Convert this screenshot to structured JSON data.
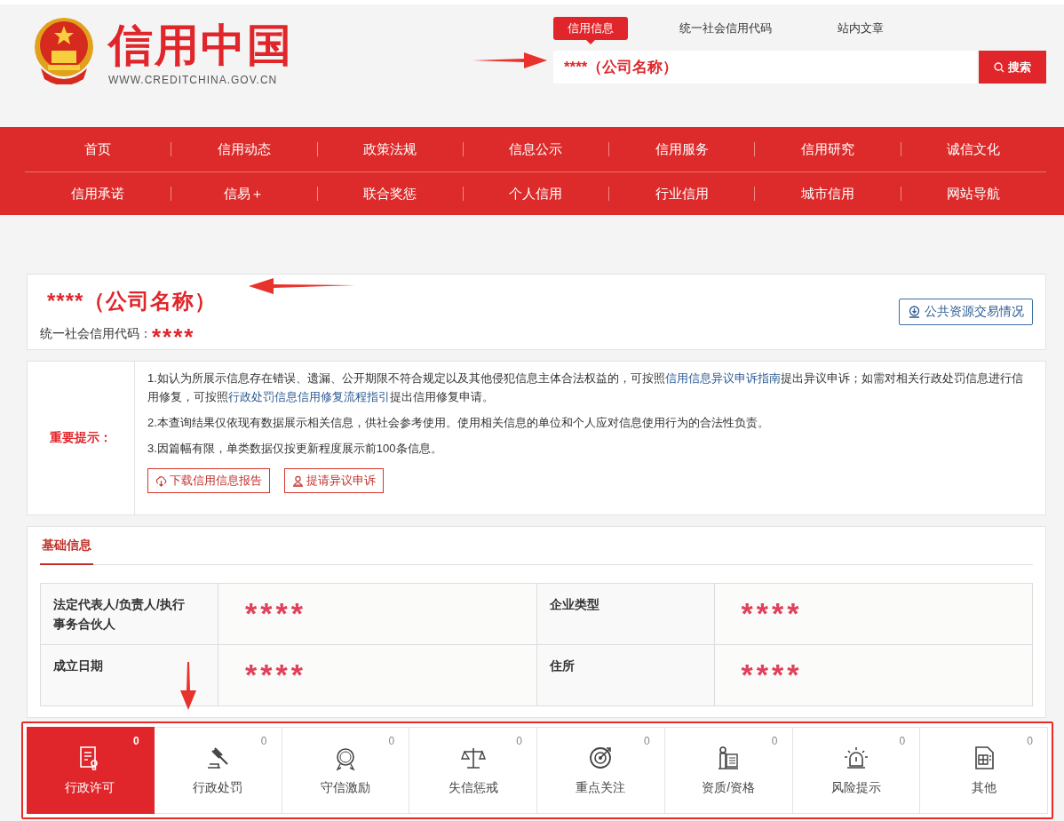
{
  "site": {
    "title": "信用中国",
    "url": "WWW.CREDITCHINA.GOV.CN"
  },
  "search": {
    "tabs": [
      {
        "label": "信用信息",
        "selected": true
      },
      {
        "label": "统一社会信用代码",
        "selected": false
      },
      {
        "label": "站内文章",
        "selected": false
      }
    ],
    "value": "****（公司名称）",
    "button": "搜索"
  },
  "nav": {
    "rows": [
      [
        "首页",
        "信用动态",
        "政策法规",
        "信息公示",
        "信用服务",
        "信用研究",
        "诚信文化"
      ],
      [
        "信用承诺",
        "信易＋",
        "联合奖惩",
        "个人信用",
        "行业信用",
        "城市信用",
        "网站导航"
      ]
    ]
  },
  "company": {
    "name": "****（公司名称）",
    "code_label": "统一社会信用代码：",
    "code": "****",
    "button": "公共资源交易情况"
  },
  "notice": {
    "title": "重要提示：",
    "items": [
      {
        "parts": [
          {
            "text": "1.如认为所展示信息存在错误、遗漏、公开期限不符合规定以及其他侵犯信息主体合法权益的，可按照"
          },
          {
            "text": "信用信息异议申诉指南",
            "kind": "link"
          },
          {
            "text": "提出异议申诉；如需对相关行政处罚信息进行信用修复，可按照"
          },
          {
            "text": "行政处罚信息信用修复流程指引",
            "kind": "link"
          },
          {
            "text": "提出信用修复申请。"
          }
        ]
      },
      {
        "parts": [
          {
            "text": "2.本查询结果仅依现有数据展示相关信息，供社会参考使用。使用相关信息的单位和个人应对信息使用行为的合法性负责。"
          }
        ]
      },
      {
        "parts": [
          {
            "text": "3.因篇幅有限，单类数据仅按更新程度展示前100条信息。"
          }
        ]
      }
    ],
    "buttons": [
      {
        "label": "下载信用信息报告",
        "kind": "download"
      },
      {
        "label": "提请异议申诉",
        "kind": "appeal"
      }
    ]
  },
  "basic_info": {
    "tab": "基础信息",
    "rows": [
      [
        {
          "label": "法定代表人/负责人/执行事务合伙人",
          "value": "****"
        },
        {
          "label": "企业类型",
          "value": "****"
        }
      ],
      [
        {
          "label": "成立日期",
          "value": "****"
        },
        {
          "label": "住所",
          "value": "****"
        }
      ]
    ]
  },
  "categories": [
    {
      "label": "行政许可",
      "count": "0",
      "selected": true,
      "kind": "license"
    },
    {
      "label": "行政处罚",
      "count": "0",
      "selected": false,
      "kind": "penalty"
    },
    {
      "label": "守信激励",
      "count": "0",
      "selected": false,
      "kind": "incentive"
    },
    {
      "label": "失信惩戒",
      "count": "0",
      "selected": false,
      "kind": "punishment"
    },
    {
      "label": "重点关注",
      "count": "0",
      "selected": false,
      "kind": "focus"
    },
    {
      "label": "资质/资格",
      "count": "0",
      "selected": false,
      "kind": "qualification"
    },
    {
      "label": "风险提示",
      "count": "0",
      "selected": false,
      "kind": "risk"
    },
    {
      "label": "其他",
      "count": "0",
      "selected": false,
      "kind": "other"
    }
  ]
}
